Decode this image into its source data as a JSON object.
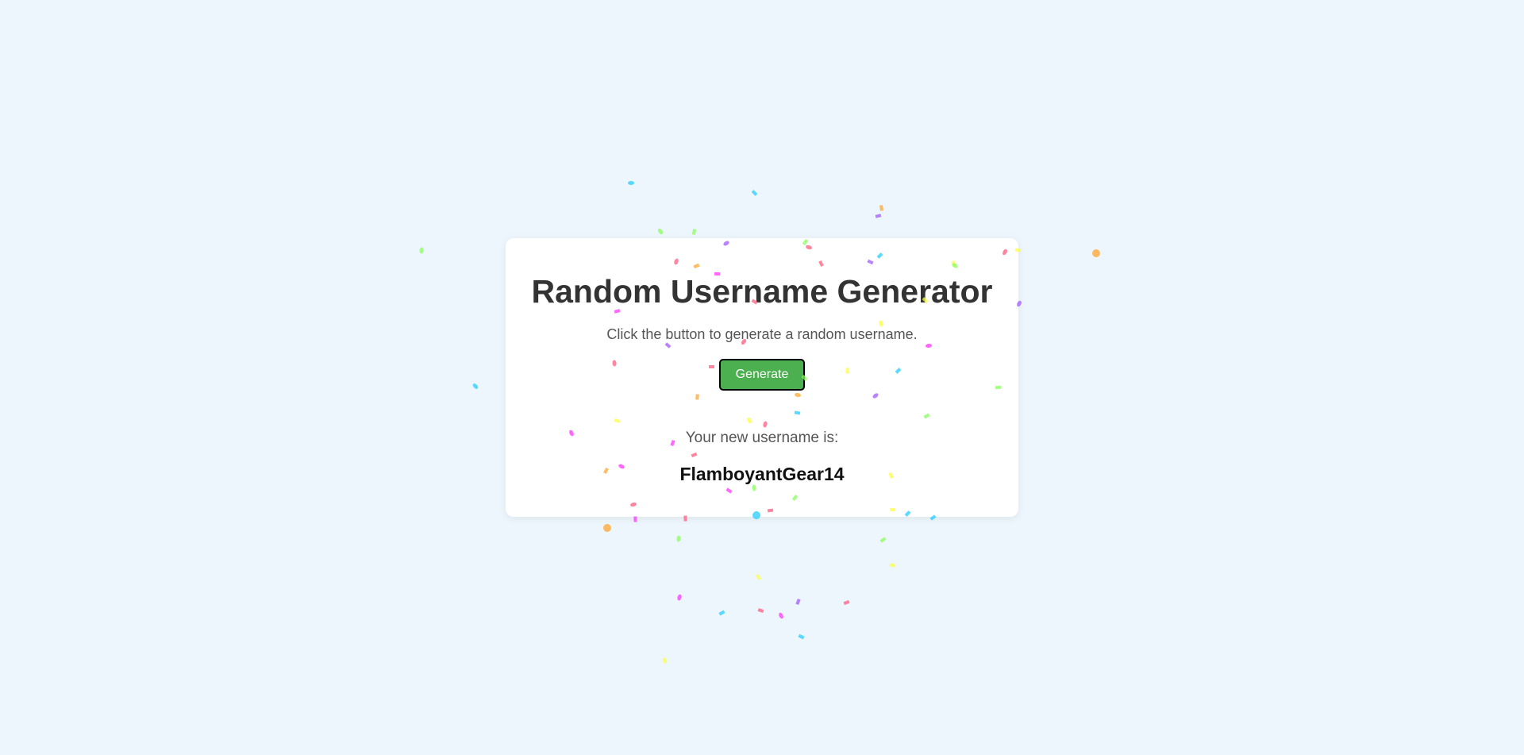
{
  "app": {
    "title": "Random Username Generator",
    "subtitle": "Click the button to generate a random username.",
    "button_label": "Generate",
    "result_label": "Your new username is:",
    "username": "FlamboyantGear14"
  },
  "colors": {
    "background": "#eef6fd",
    "card": "#ffffff",
    "button": "#4caf50",
    "confetti": [
      "#26ccff",
      "#a25afd",
      "#ff5e7e",
      "#88ff5a",
      "#fcff42",
      "#ffa62d",
      "#ff36ff"
    ]
  }
}
